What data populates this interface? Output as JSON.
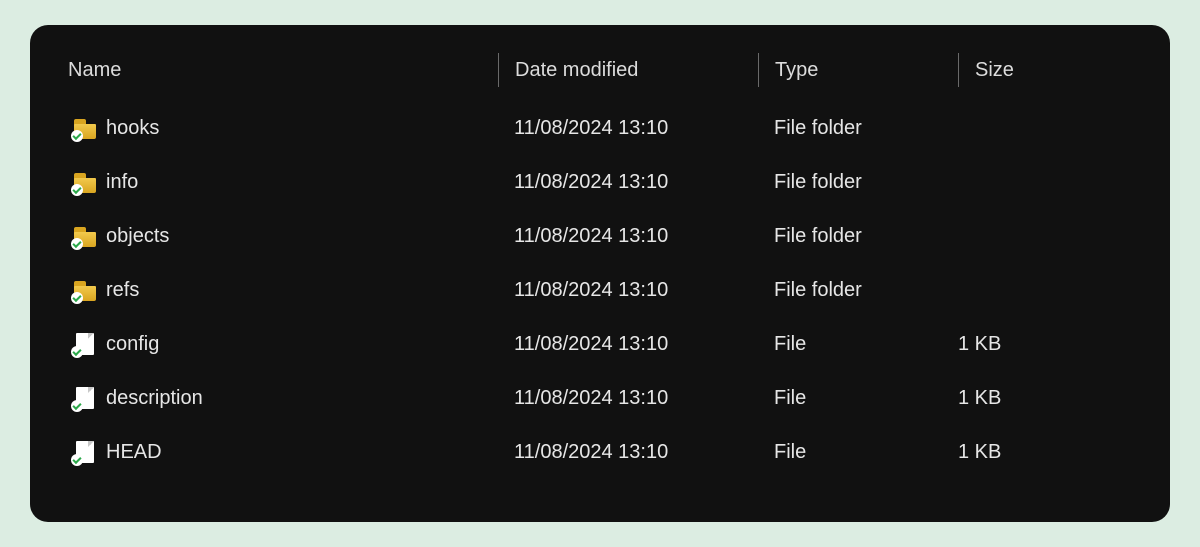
{
  "columns": {
    "name": "Name",
    "date_modified": "Date modified",
    "type": "Type",
    "size": "Size"
  },
  "items": [
    {
      "icon": "folder",
      "name": "hooks",
      "date": "11/08/2024 13:10",
      "type": "File folder",
      "size": ""
    },
    {
      "icon": "folder",
      "name": "info",
      "date": "11/08/2024 13:10",
      "type": "File folder",
      "size": ""
    },
    {
      "icon": "folder",
      "name": "objects",
      "date": "11/08/2024 13:10",
      "type": "File folder",
      "size": ""
    },
    {
      "icon": "folder",
      "name": "refs",
      "date": "11/08/2024 13:10",
      "type": "File folder",
      "size": ""
    },
    {
      "icon": "file",
      "name": "config",
      "date": "11/08/2024 13:10",
      "type": "File",
      "size": "1 KB"
    },
    {
      "icon": "file",
      "name": "description",
      "date": "11/08/2024 13:10",
      "type": "File",
      "size": "1 KB"
    },
    {
      "icon": "file",
      "name": "HEAD",
      "date": "11/08/2024 13:10",
      "type": "File",
      "size": "1 KB"
    }
  ]
}
